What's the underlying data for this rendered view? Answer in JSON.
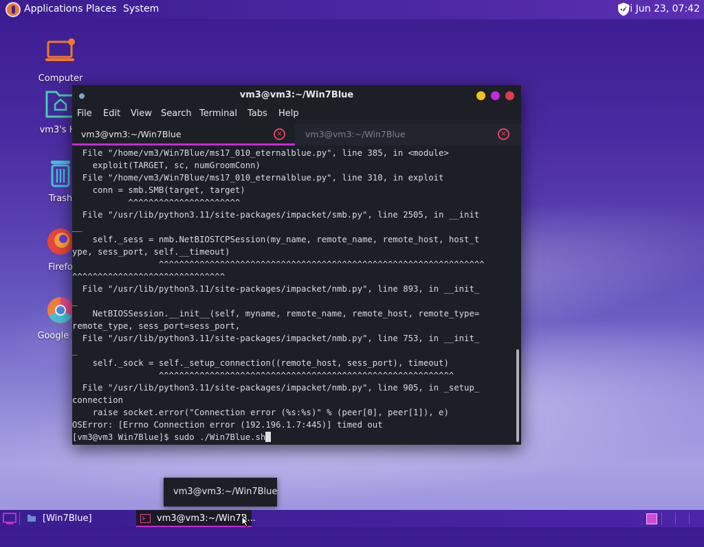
{
  "top_panel": {
    "menu": [
      "Applications",
      "Places",
      "System"
    ],
    "clock": "Fri Jun 23, 07:42"
  },
  "desktop_icons": [
    {
      "label": "Computer",
      "icon": "computer-icon"
    },
    {
      "label": "vm3's Ho",
      "icon": "home-folder-icon"
    },
    {
      "label": "Trash",
      "icon": "trash-icon"
    },
    {
      "label": "Firefo",
      "icon": "firefox-icon"
    },
    {
      "label": "Google Ch",
      "icon": "chrome-icon"
    }
  ],
  "terminal": {
    "title": "vm3@vm3:~/Win7Blue",
    "menu": [
      "File",
      "Edit",
      "View",
      "Search",
      "Terminal",
      "Tabs",
      "Help"
    ],
    "tabs": [
      {
        "label": "vm3@vm3:~/Win7Blue",
        "active": true
      },
      {
        "label": "vm3@vm3:~/Win7Blue",
        "active": false
      }
    ],
    "lines": [
      "  File \"/home/vm3/Win7Blue/ms17_010_eternalblue.py\", line 385, in <module>",
      "    exploit(TARGET, sc, numGroomConn)",
      "  File \"/home/vm3/Win7Blue/ms17_010_eternalblue.py\", line 310, in exploit",
      "    conn = smb.SMB(target, target)",
      "           ^^^^^^^^^^^^^^^^^^^^^^",
      "  File \"/usr/lib/python3.11/site-packages/impacket/smb.py\", line 2505, in __init",
      "__",
      "    self._sess = nmb.NetBIOSTCPSession(my_name, remote_name, remote_host, host_t",
      "ype, sess_port, self.__timeout)",
      "                 ^^^^^^^^^^^^^^^^^^^^^^^^^^^^^^^^^^^^^^^^^^^^^^^^^^^^^^^^^^^^^^^^",
      "^^^^^^^^^^^^^^^^^^^^^^^^^^^^^^",
      "  File \"/usr/lib/python3.11/site-packages/impacket/nmb.py\", line 893, in __init_",
      "_",
      "    NetBIOSSession.__init__(self, myname, remote_name, remote_host, remote_type=",
      "remote_type, sess_port=sess_port,",
      "  File \"/usr/lib/python3.11/site-packages/impacket/nmb.py\", line 753, in __init_",
      "_",
      "    self._sock = self._setup_connection((remote_host, sess_port), timeout)",
      "                 ^^^^^^^^^^^^^^^^^^^^^^^^^^^^^^^^^^^^^^^^^^^^^^^^^^^^^^^^^^",
      "  File \"/usr/lib/python3.11/site-packages/impacket/nmb.py\", line 905, in _setup_",
      "connection",
      "    raise socket.error(\"Connection error (%s:%s)\" % (peer[0], peer[1]), e)",
      "OSError: [Errno Connection error (192.196.1.7:445)] timed out"
    ],
    "prompt": "[vm3@vm3 Win7Blue]$ sudo ./Win7Blue.sh"
  },
  "tooltip": "vm3@vm3:~/Win7Blue",
  "taskbar": {
    "items": [
      {
        "label": "[Win7Blue]",
        "icon": "folder-icon",
        "active": false
      },
      {
        "label": "vm3@vm3:~/Win7B...",
        "icon": "terminal-icon",
        "active": true
      }
    ]
  },
  "colors": {
    "accent": "#c42bd6",
    "close_red": "#e0455b",
    "btn_yellow": "#f3c31c",
    "btn_purple": "#c42bd6",
    "btn_red": "#e03a4d"
  }
}
